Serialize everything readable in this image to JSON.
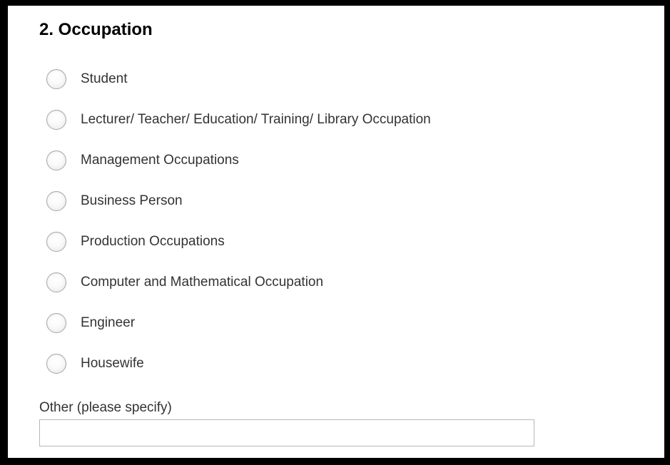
{
  "question": {
    "title": "2. Occupation"
  },
  "options": [
    {
      "label": "Student",
      "selected": false
    },
    {
      "label": "Lecturer/ Teacher/ Education/ Training/ Library Occupation",
      "selected": false
    },
    {
      "label": "Management Occupations",
      "selected": false
    },
    {
      "label": "Business Person",
      "selected": false
    },
    {
      "label": "Production Occupations",
      "selected": false
    },
    {
      "label": "Computer and Mathematical Occupation",
      "selected": false
    },
    {
      "label": "Engineer",
      "selected": false
    },
    {
      "label": "Housewife",
      "selected": false
    }
  ],
  "other": {
    "label": "Other (please specify)",
    "value": ""
  },
  "colors": {
    "frame": "#000000",
    "panel": "#ffffff",
    "title_text": "#000000",
    "label_text": "#333333",
    "radio_border": "#a7a7a7",
    "input_border": "#b7b7b7"
  },
  "icons": {
    "option_control": "radio-button-icon"
  }
}
